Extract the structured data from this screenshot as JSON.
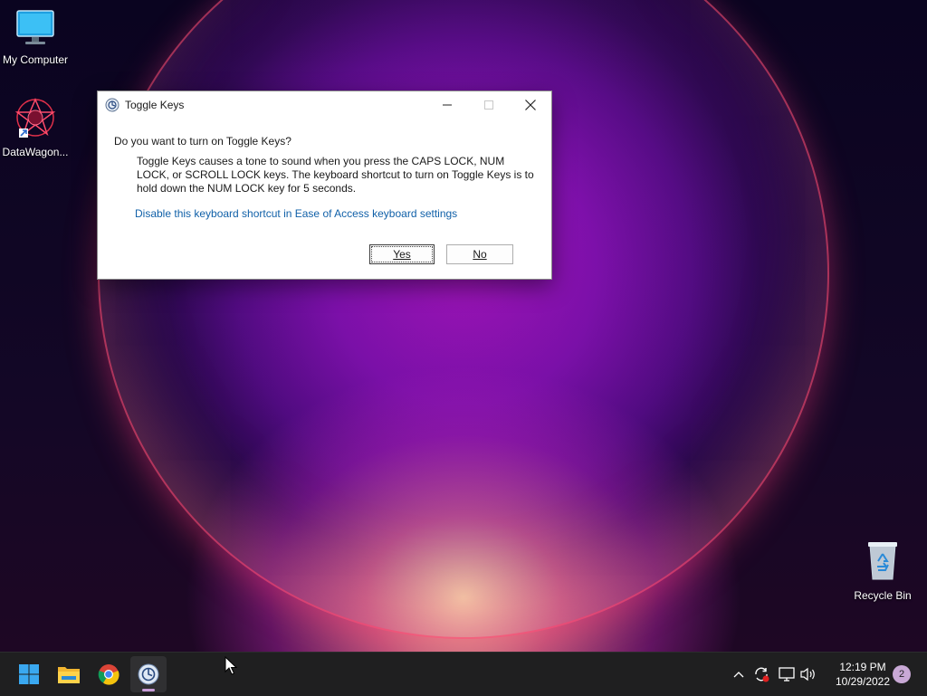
{
  "desktop": {
    "icons": [
      {
        "label": "My Computer",
        "icon": "monitor-icon"
      },
      {
        "label": "DataWagon...",
        "icon": "datawagon-shortcut-icon"
      },
      {
        "label": "Recycle Bin",
        "icon": "recycle-bin-icon"
      }
    ]
  },
  "dialog": {
    "title": "Toggle Keys",
    "question": "Do you want to turn on Toggle Keys?",
    "body": "Toggle Keys causes a tone to sound when you press the CAPS LOCK, NUM LOCK, or SCROLL LOCK keys.  The keyboard shortcut to turn on Toggle Keys is to hold down the NUM LOCK key for 5 seconds.",
    "link": "Disable this keyboard shortcut in Ease of Access keyboard settings",
    "yes_label": "Yes",
    "no_label": "No"
  },
  "taskbar": {
    "apps": [
      "windows-start-icon",
      "file-explorer-icon",
      "chrome-icon",
      "ease-of-access-icon"
    ],
    "clock_time": "12:19 PM",
    "clock_date": "10/29/2022",
    "notification_count": "2"
  },
  "colors": {
    "link": "#1060a8",
    "taskbar_bg": "#1f1f20",
    "accent_badge": "#c9a9d6"
  }
}
